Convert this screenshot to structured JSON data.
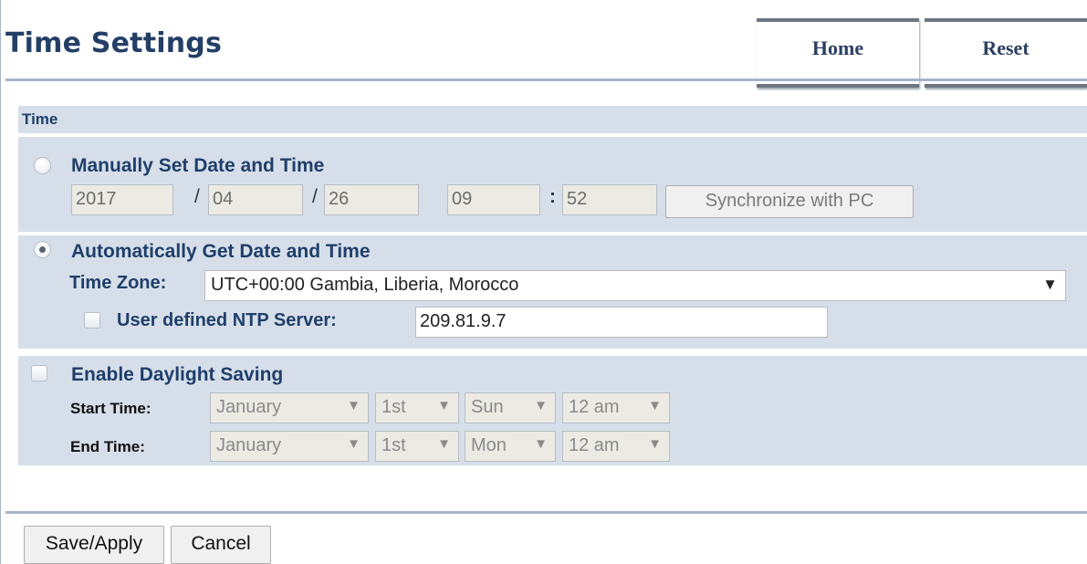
{
  "page": {
    "title": "Time Settings",
    "home_label": "Home",
    "reset_label": "Reset"
  },
  "time_section": {
    "header": "Time",
    "manual": {
      "label": "Manually Set Date and Time",
      "selected": false,
      "year": "2017",
      "month": "04",
      "day": "26",
      "hour": "09",
      "minute": "52",
      "date_separator": "/",
      "time_separator": ":",
      "sync_label": "Synchronize with PC"
    },
    "automatic": {
      "label": "Automatically Get Date and Time",
      "selected": true,
      "timezone_label": "Time Zone:",
      "timezone_value": "UTC+00:00 Gambia, Liberia, Morocco",
      "ntp_label": "User defined NTP Server:",
      "ntp_checked": false,
      "ntp_value": "209.81.9.7"
    },
    "daylight": {
      "label": "Enable Daylight Saving",
      "checked": false,
      "start_label": "Start Time:",
      "end_label": "End Time:",
      "start": {
        "month": "January",
        "week": "1st",
        "day": "Sun",
        "hour": "12 am"
      },
      "end": {
        "month": "January",
        "week": "1st",
        "day": "Mon",
        "hour": "12 am"
      }
    }
  },
  "footer": {
    "save_label": "Save/Apply",
    "cancel_label": "Cancel"
  },
  "colors": {
    "heading": "#243f66",
    "band": "#d6dfe9",
    "rule": "#a4b4c9"
  },
  "icons": {
    "dropdown_arrow": "▼"
  }
}
